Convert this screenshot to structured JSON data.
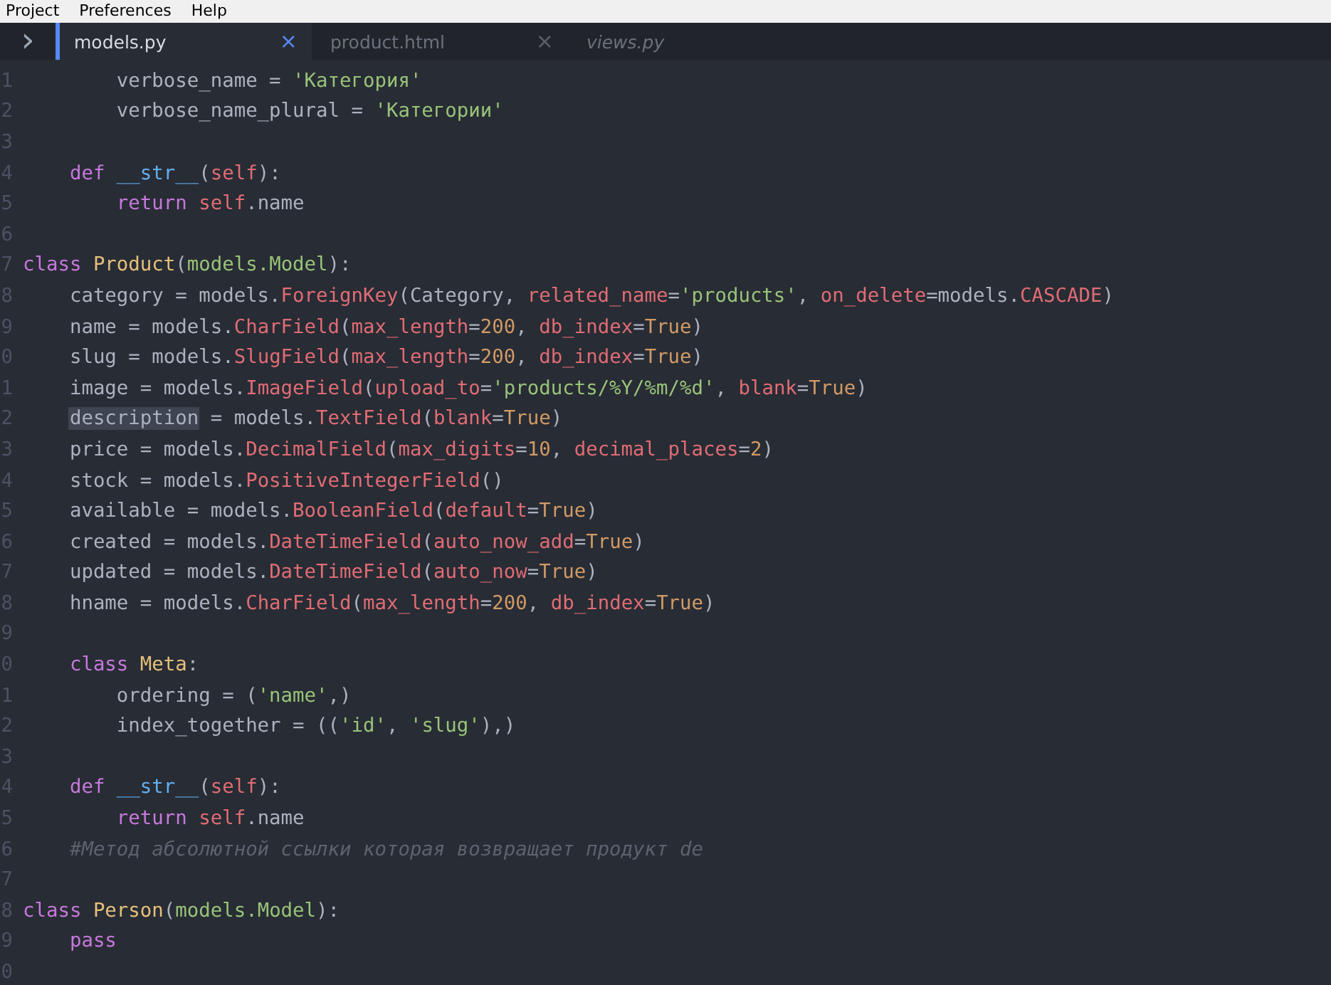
{
  "menu_bar": {
    "items": [
      "Project",
      "Preferences",
      "Help"
    ]
  },
  "tabs": [
    {
      "label": "models.py",
      "selected": true,
      "italic": false,
      "close": "×"
    },
    {
      "label": "product.html",
      "selected": false,
      "italic": false,
      "close": "×"
    },
    {
      "label": "views.py",
      "selected": false,
      "italic": true
    }
  ],
  "sidebar_toggle": "›",
  "editor": {
    "lines": [
      {
        "number": "1",
        "tokens": [
          {
            "text": "        verbose_name = ",
            "kind": "plain"
          },
          {
            "text": "'Категория'",
            "kind": "string"
          }
        ]
      },
      {
        "number": "2",
        "tokens": [
          {
            "text": "        verbose_name_plural = ",
            "kind": "plain"
          },
          {
            "text": "'Категории'",
            "kind": "string"
          }
        ]
      },
      {
        "number": "3"
      },
      {
        "number": "4",
        "tokens": [
          {
            "text": "    def",
            "kind": "keyword"
          },
          {
            "text": " __str__",
            "kind": "func"
          },
          {
            "text": "(",
            "kind": "plain"
          },
          {
            "text": "self",
            "kind": "param"
          },
          {
            "text": "):",
            "kind": "plain"
          }
        ]
      },
      {
        "number": "5",
        "tokens": [
          {
            "text": "        return",
            "kind": "keyword"
          },
          {
            "text": " self",
            "kind": "param"
          },
          {
            "text": ".name",
            "kind": "plain"
          }
        ]
      },
      {
        "number": "6"
      },
      {
        "number": "7",
        "tokens": [
          {
            "text": "class",
            "kind": "keyword"
          },
          {
            "text": " Product",
            "kind": "class"
          },
          {
            "text": "(",
            "kind": "plain"
          },
          {
            "text": "models.Model",
            "kind": "string"
          },
          {
            "text": "):",
            "kind": "plain"
          }
        ]
      },
      {
        "number": "8",
        "tokens": [
          {
            "text": "    category = models.",
            "kind": "plain"
          },
          {
            "text": "ForeignKey",
            "kind": "call"
          },
          {
            "text": "(Category, ",
            "kind": "plain"
          },
          {
            "text": "related_name",
            "kind": "param"
          },
          {
            "text": "=",
            "kind": "plain"
          },
          {
            "text": "'products'",
            "kind": "string"
          },
          {
            "text": ", ",
            "kind": "plain"
          },
          {
            "text": "on_delete",
            "kind": "param"
          },
          {
            "text": "=models.",
            "kind": "plain"
          },
          {
            "text": "CASCADE",
            "kind": "call"
          },
          {
            "text": ")",
            "kind": "plain"
          }
        ]
      },
      {
        "number": "9",
        "tokens": [
          {
            "text": "    name = models.",
            "kind": "plain"
          },
          {
            "text": "CharField",
            "kind": "call"
          },
          {
            "text": "(",
            "kind": "plain"
          },
          {
            "text": "max_length",
            "kind": "param"
          },
          {
            "text": "=",
            "kind": "plain"
          },
          {
            "text": "200",
            "kind": "number"
          },
          {
            "text": ", ",
            "kind": "plain"
          },
          {
            "text": "db_index",
            "kind": "param"
          },
          {
            "text": "=",
            "kind": "plain"
          },
          {
            "text": "True",
            "kind": "number"
          },
          {
            "text": ")",
            "kind": "plain"
          }
        ]
      },
      {
        "number": "0",
        "tokens": [
          {
            "text": "    slug = models.",
            "kind": "plain"
          },
          {
            "text": "SlugField",
            "kind": "call"
          },
          {
            "text": "(",
            "kind": "plain"
          },
          {
            "text": "max_length",
            "kind": "param"
          },
          {
            "text": "=",
            "kind": "plain"
          },
          {
            "text": "200",
            "kind": "number"
          },
          {
            "text": ", ",
            "kind": "plain"
          },
          {
            "text": "db_index",
            "kind": "param"
          },
          {
            "text": "=",
            "kind": "plain"
          },
          {
            "text": "True",
            "kind": "number"
          },
          {
            "text": ")",
            "kind": "plain"
          }
        ]
      },
      {
        "number": "1",
        "tokens": [
          {
            "text": "    image = models.",
            "kind": "plain"
          },
          {
            "text": "ImageField",
            "kind": "call"
          },
          {
            "text": "(",
            "kind": "plain"
          },
          {
            "text": "upload_to",
            "kind": "param"
          },
          {
            "text": "=",
            "kind": "plain"
          },
          {
            "text": "'products/%Y/%m/%d'",
            "kind": "string"
          },
          {
            "text": ", ",
            "kind": "plain"
          },
          {
            "text": "blank",
            "kind": "param"
          },
          {
            "text": "=",
            "kind": "plain"
          },
          {
            "text": "True",
            "kind": "number"
          },
          {
            "text": ")",
            "kind": "plain"
          }
        ]
      },
      {
        "number": "2",
        "tokens": [
          {
            "text": "    description",
            "kind": "highlight"
          },
          {
            "text": " = models.",
            "kind": "plain"
          },
          {
            "text": "TextField",
            "kind": "call"
          },
          {
            "text": "(",
            "kind": "plain"
          },
          {
            "text": "blank",
            "kind": "param"
          },
          {
            "text": "=",
            "kind": "plain"
          },
          {
            "text": "True",
            "kind": "number"
          },
          {
            "text": ")",
            "kind": "plain"
          }
        ]
      },
      {
        "number": "3",
        "tokens": [
          {
            "text": "    price = models.",
            "kind": "plain"
          },
          {
            "text": "DecimalField",
            "kind": "call"
          },
          {
            "text": "(",
            "kind": "plain"
          },
          {
            "text": "max_digits",
            "kind": "param"
          },
          {
            "text": "=",
            "kind": "plain"
          },
          {
            "text": "10",
            "kind": "number"
          },
          {
            "text": ", ",
            "kind": "plain"
          },
          {
            "text": "decimal_places",
            "kind": "param"
          },
          {
            "text": "=",
            "kind": "plain"
          },
          {
            "text": "2",
            "kind": "number"
          },
          {
            "text": ")",
            "kind": "plain"
          }
        ]
      },
      {
        "number": "4",
        "tokens": [
          {
            "text": "    stock = models.",
            "kind": "plain"
          },
          {
            "text": "PositiveIntegerField",
            "kind": "call"
          },
          {
            "text": "()",
            "kind": "plain"
          }
        ]
      },
      {
        "number": "5",
        "tokens": [
          {
            "text": "    available = models.",
            "kind": "plain"
          },
          {
            "text": "BooleanField",
            "kind": "call"
          },
          {
            "text": "(",
            "kind": "plain"
          },
          {
            "text": "default",
            "kind": "param"
          },
          {
            "text": "=",
            "kind": "plain"
          },
          {
            "text": "True",
            "kind": "number"
          },
          {
            "text": ")",
            "kind": "plain"
          }
        ]
      },
      {
        "number": "6",
        "tokens": [
          {
            "text": "    created = models.",
            "kind": "plain"
          },
          {
            "text": "DateTimeField",
            "kind": "call"
          },
          {
            "text": "(",
            "kind": "plain"
          },
          {
            "text": "auto_now_add",
            "kind": "param"
          },
          {
            "text": "=",
            "kind": "plain"
          },
          {
            "text": "True",
            "kind": "number"
          },
          {
            "text": ")",
            "kind": "plain"
          }
        ]
      },
      {
        "number": "7",
        "tokens": [
          {
            "text": "    updated = models.",
            "kind": "plain"
          },
          {
            "text": "DateTimeField",
            "kind": "call"
          },
          {
            "text": "(",
            "kind": "plain"
          },
          {
            "text": "auto_now",
            "kind": "param"
          },
          {
            "text": "=",
            "kind": "plain"
          },
          {
            "text": "True",
            "kind": "number"
          },
          {
            "text": ")",
            "kind": "plain"
          }
        ]
      },
      {
        "number": "8",
        "tokens": [
          {
            "text": "    hname = models.",
            "kind": "plain"
          },
          {
            "text": "CharField",
            "kind": "call"
          },
          {
            "text": "(",
            "kind": "plain"
          },
          {
            "text": "max_length",
            "kind": "param"
          },
          {
            "text": "=",
            "kind": "plain"
          },
          {
            "text": "200",
            "kind": "number"
          },
          {
            "text": ", ",
            "kind": "plain"
          },
          {
            "text": "db_index",
            "kind": "param"
          },
          {
            "text": "=",
            "kind": "plain"
          },
          {
            "text": "True",
            "kind": "number"
          },
          {
            "text": ")",
            "kind": "plain"
          }
        ]
      },
      {
        "number": "9"
      },
      {
        "number": "0",
        "tokens": [
          {
            "text": "    class",
            "kind": "keyword"
          },
          {
            "text": " Meta",
            "kind": "class"
          },
          {
            "text": ":",
            "kind": "plain"
          }
        ]
      },
      {
        "number": "1",
        "tokens": [
          {
            "text": "        ordering = (",
            "kind": "plain"
          },
          {
            "text": "'name'",
            "kind": "string"
          },
          {
            "text": ",)",
            "kind": "plain"
          }
        ]
      },
      {
        "number": "2",
        "tokens": [
          {
            "text": "        index_together = ((",
            "kind": "plain"
          },
          {
            "text": "'id'",
            "kind": "string"
          },
          {
            "text": ", ",
            "kind": "plain"
          },
          {
            "text": "'slug'",
            "kind": "string"
          },
          {
            "text": "),)",
            "kind": "plain"
          }
        ]
      },
      {
        "number": "3"
      },
      {
        "number": "4",
        "tokens": [
          {
            "text": "    def",
            "kind": "keyword"
          },
          {
            "text": " __str__",
            "kind": "func"
          },
          {
            "text": "(",
            "kind": "plain"
          },
          {
            "text": "self",
            "kind": "param"
          },
          {
            "text": "):",
            "kind": "plain"
          }
        ]
      },
      {
        "number": "5",
        "tokens": [
          {
            "text": "        return",
            "kind": "keyword"
          },
          {
            "text": " self",
            "kind": "param"
          },
          {
            "text": ".name",
            "kind": "plain"
          }
        ]
      },
      {
        "number": "6",
        "tokens": [
          {
            "text": "    #Метод абсолютной ссылки которая возвращает продукт de",
            "kind": "comment"
          }
        ]
      },
      {
        "number": "7"
      },
      {
        "number": "8",
        "tokens": [
          {
            "text": "class",
            "kind": "keyword"
          },
          {
            "text": " Person",
            "kind": "class"
          },
          {
            "text": "(",
            "kind": "plain"
          },
          {
            "text": "models.Model",
            "kind": "string"
          },
          {
            "text": "):",
            "kind": "plain"
          }
        ]
      },
      {
        "number": "9",
        "tokens": [
          {
            "text": "    pass",
            "kind": "keyword"
          }
        ]
      },
      {
        "number": "0"
      }
    ]
  }
}
